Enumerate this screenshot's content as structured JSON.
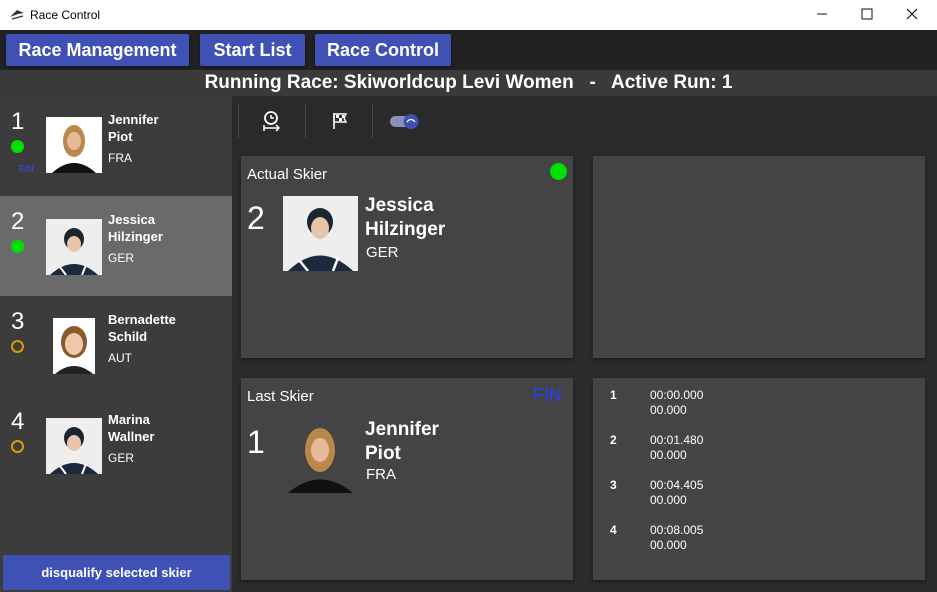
{
  "window": {
    "title": "Race Control"
  },
  "menu": {
    "race_management": "Race Management",
    "start_list": "Start List",
    "race_control": "Race Control"
  },
  "header": {
    "running_race": "Running Race: Skiworldcup Levi Women   -   Active Run: 1"
  },
  "skiers": [
    {
      "number": "1",
      "first": "Jennifer",
      "last": "Piot",
      "nation": "FRA",
      "status": "green",
      "fin": "FIN"
    },
    {
      "number": "2",
      "first": "Jessica",
      "last": "Hilzinger",
      "nation": "GER",
      "status": "green",
      "selected": true
    },
    {
      "number": "3",
      "first": "Bernadette",
      "last": "Schild",
      "nation": "AUT",
      "status": "waiting"
    },
    {
      "number": "4",
      "first": "Marina",
      "last": "Wallner",
      "nation": "GER",
      "status": "waiting"
    }
  ],
  "disqualify_label": "disqualify selected skier",
  "toolbar": {
    "icons": [
      "timer-start-icon",
      "finish-flag-icon",
      "toggle-switch-icon"
    ]
  },
  "actual": {
    "title": "Actual Skier",
    "number": "2",
    "first": "Jessica",
    "last": "Hilzinger",
    "nation": "GER"
  },
  "last": {
    "title": "Last Skier",
    "number": "1",
    "first": "Jennifer",
    "last": "Piot",
    "nation": "FRA",
    "fin": "FIN"
  },
  "splits": [
    {
      "n": "1",
      "time": "00:00.000",
      "diff": "00.000"
    },
    {
      "n": "2",
      "time": "00:01.480",
      "diff": "00.000"
    },
    {
      "n": "3",
      "time": "00:04.405",
      "diff": "00.000"
    },
    {
      "n": "4",
      "time": "00:08.005",
      "diff": "00.000"
    }
  ],
  "colors": {
    "accent": "#3f51b5",
    "finished": "#00e000",
    "waiting": "#e09a00",
    "fin_text": "#2040ff"
  }
}
